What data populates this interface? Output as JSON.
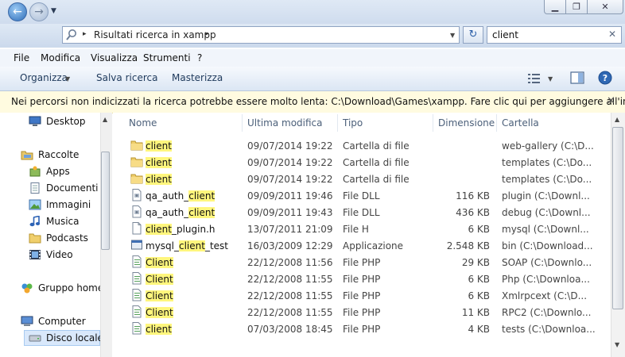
{
  "window": {
    "min_label": "▁",
    "max_label": "❐",
    "close_label": "✕"
  },
  "address": {
    "breadcrumb_sep": "▸",
    "path": "Risultati ricerca in xampp",
    "path_end": "▸"
  },
  "search": {
    "value": "client",
    "clear": "✕"
  },
  "menu": [
    "File",
    "Modifica",
    "Visualizza",
    "Strumenti",
    "?"
  ],
  "toolbar": {
    "organize": "Organizza",
    "save_search": "Salva ricerca",
    "burn": "Masterizza"
  },
  "infobar": {
    "text": "Nei percorsi non indicizzati la ricerca potrebbe essere molto lenta: C:\\Download\\Games\\xampp. Fare clic qui per aggiungere all'indice.",
    "close": "✕"
  },
  "nav": {
    "desktop": "Desktop",
    "libraries": "Raccolte",
    "apps": "Apps",
    "documents": "Documenti",
    "images": "Immagini",
    "music": "Musica",
    "podcasts": "Podcasts",
    "video": "Video",
    "homegroup": "Gruppo home",
    "computer": "Computer",
    "local_disk": "Disco locale"
  },
  "columns": {
    "name": "Nome",
    "modified": "Ultima modifica",
    "type": "Tipo",
    "size": "Dimensione",
    "folder": "Cartella"
  },
  "rows": [
    {
      "icon": "folder-icon",
      "pre": "",
      "hl": "client",
      "post": "",
      "modified": "09/07/2014 19:22",
      "type": "Cartella di file",
      "size": "",
      "folder": "web-gallery (C:\\D..."
    },
    {
      "icon": "folder-icon",
      "pre": "",
      "hl": "client",
      "post": "",
      "modified": "09/07/2014 19:22",
      "type": "Cartella di file",
      "size": "",
      "folder": "templates (C:\\Do..."
    },
    {
      "icon": "folder-icon",
      "pre": "",
      "hl": "client",
      "post": "",
      "modified": "09/07/2014 19:22",
      "type": "Cartella di file",
      "size": "",
      "folder": "templates (C:\\Do..."
    },
    {
      "icon": "dll-file-icon",
      "pre": "qa_auth_",
      "hl": "client",
      "post": "",
      "modified": "09/09/2011 19:46",
      "type": "File DLL",
      "size": "116 KB",
      "folder": "plugin (C:\\Downl..."
    },
    {
      "icon": "dll-file-icon",
      "pre": "qa_auth_",
      "hl": "client",
      "post": "",
      "modified": "09/09/2011 19:43",
      "type": "File DLL",
      "size": "436 KB",
      "folder": "debug (C:\\Downl..."
    },
    {
      "icon": "h-file-icon",
      "pre": "",
      "hl": "client",
      "post": "_plugin.h",
      "modified": "13/07/2011 21:09",
      "type": "File H",
      "size": "6 KB",
      "folder": "mysql (C:\\Downl..."
    },
    {
      "icon": "exe-file-icon",
      "pre": "mysql_",
      "hl": "client",
      "post": "_test",
      "modified": "16/03/2009 12:29",
      "type": "Applicazione",
      "size": "2.548 KB",
      "folder": "bin (C:\\Download..."
    },
    {
      "icon": "php-file-icon",
      "pre": "",
      "hl": "Client",
      "post": "",
      "modified": "22/12/2008 11:56",
      "type": "File PHP",
      "size": "29 KB",
      "folder": "SOAP (C:\\Downlo..."
    },
    {
      "icon": "php-file-icon",
      "pre": "",
      "hl": "Client",
      "post": "",
      "modified": "22/12/2008 11:55",
      "type": "File PHP",
      "size": "6 KB",
      "folder": "Php (C:\\Downloa..."
    },
    {
      "icon": "php-file-icon",
      "pre": "",
      "hl": "Client",
      "post": "",
      "modified": "22/12/2008 11:55",
      "type": "File PHP",
      "size": "6 KB",
      "folder": "Xmlrpcext (C:\\D..."
    },
    {
      "icon": "php-file-icon",
      "pre": "",
      "hl": "Client",
      "post": "",
      "modified": "22/12/2008 11:55",
      "type": "File PHP",
      "size": "11 KB",
      "folder": "RPC2 (C:\\Downlo..."
    },
    {
      "icon": "php-file-icon",
      "pre": "",
      "hl": "client",
      "post": "",
      "modified": "07/03/2008 18:45",
      "type": "File PHP",
      "size": "4 KB",
      "folder": "tests (C:\\Downloa..."
    }
  ]
}
